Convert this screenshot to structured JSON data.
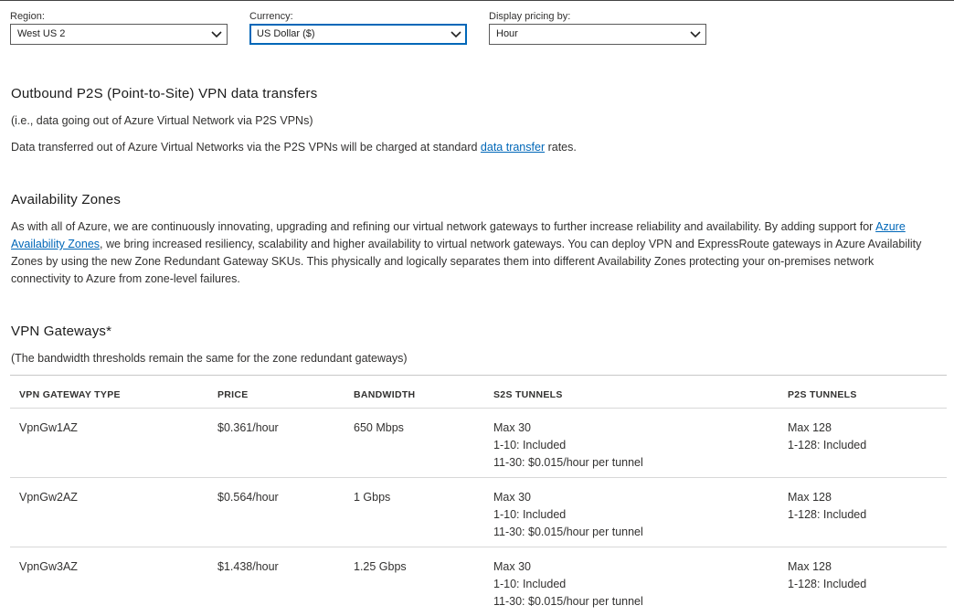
{
  "filters": {
    "region": {
      "label": "Region:",
      "value": "West US 2"
    },
    "currency": {
      "label": "Currency:",
      "value": "US Dollar ($)"
    },
    "display": {
      "label": "Display pricing by:",
      "value": "Hour"
    }
  },
  "outbound": {
    "heading": "Outbound P2S (Point-to-Site) VPN data transfers",
    "note": "(i.e., data going out of Azure Virtual Network via P2S VPNs)",
    "text_before": "Data transferred out of Azure Virtual Networks via the P2S VPNs will be charged at standard ",
    "link": "data transfer",
    "text_after": " rates."
  },
  "az": {
    "heading": "Availability Zones",
    "line1_text": "As with all of Azure, we are continuously innovating, upgrading and refining our virtual network gateways to further increase reliability and availability. By adding support for ",
    "line1_link": "Azure",
    "line2_link": "Availability Zones",
    "line2_text": ", we bring increased resiliency, scalability and higher availability to virtual network gateways. You can deploy VPN and ExpressRoute gateways in Azure Availability",
    "line3": "Zones by using the new Zone Redundant Gateway SKUs. This physically and logically separates them into different Availability Zones protecting your on-premises network",
    "line4": "connectivity to Azure from zone-level failures."
  },
  "vpn": {
    "heading": "VPN Gateways*",
    "note": "(The bandwidth thresholds remain the same for the zone redundant gateways)",
    "columns": [
      "VPN GATEWAY TYPE",
      "PRICE",
      "BANDWIDTH",
      "S2S TUNNELS",
      "P2S TUNNELS"
    ],
    "rows": [
      {
        "type": "VpnGw1AZ",
        "price": "$0.361/hour",
        "bandwidth": "650 Mbps",
        "s2s": [
          "Max 30",
          "1-10: Included",
          "11-30: $0.015/hour per tunnel"
        ],
        "p2s": [
          "Max 128",
          "1-128: Included"
        ]
      },
      {
        "type": "VpnGw2AZ",
        "price": "$0.564/hour",
        "bandwidth": "1 Gbps",
        "s2s": [
          "Max 30",
          "1-10: Included",
          "11-30: $0.015/hour per tunnel"
        ],
        "p2s": [
          "Max 128",
          "1-128: Included"
        ]
      },
      {
        "type": "VpnGw3AZ",
        "price": "$1.438/hour",
        "bandwidth": "1.25 Gbps",
        "s2s": [
          "Max 30",
          "1-10: Included",
          "11-30: $0.015/hour per tunnel"
        ],
        "p2s": [
          "Max 128",
          "1-128: Included"
        ]
      }
    ]
  }
}
